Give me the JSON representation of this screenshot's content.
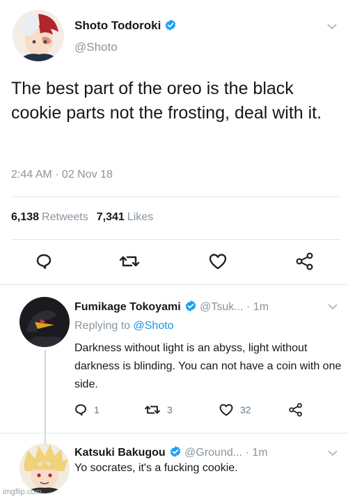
{
  "tweet": {
    "author_name": "Shoto Todoroki",
    "author_handle": "@Shoto",
    "text": "The best part of the oreo is the black cookie parts not the frosting, deal with it.",
    "timestamp": "2:44 AM · 02 Nov 18",
    "retweets_count": "6,138",
    "retweets_label": "Retweets",
    "likes_count": "7,341",
    "likes_label": "Likes",
    "icons": [
      "reply-icon",
      "retweet-icon",
      "like-icon",
      "share-icon"
    ]
  },
  "replies": [
    {
      "author_name": "Fumikage Tokoyami",
      "author_handle": "@Tsuk...",
      "time": "· 1m",
      "replying_to_label": "Replying to",
      "replying_to_handle": "@Shoto",
      "text": "Darkness without light is an abyss, light without darkness is blinding. You can not have a coin with one side.",
      "reply_count": "1",
      "retweet_count": "3",
      "like_count": "32"
    },
    {
      "author_name": "Katsuki Bakugou",
      "author_handle": "@Ground...",
      "time": "· 1m",
      "text": "Yo socrates, it's a fucking cookie."
    }
  ],
  "watermark": "imgflip.com",
  "colors": {
    "verified": "#1da1f2",
    "mention": "#1b95e0",
    "muted": "#8a959e",
    "divider": "#e1e8ed"
  }
}
